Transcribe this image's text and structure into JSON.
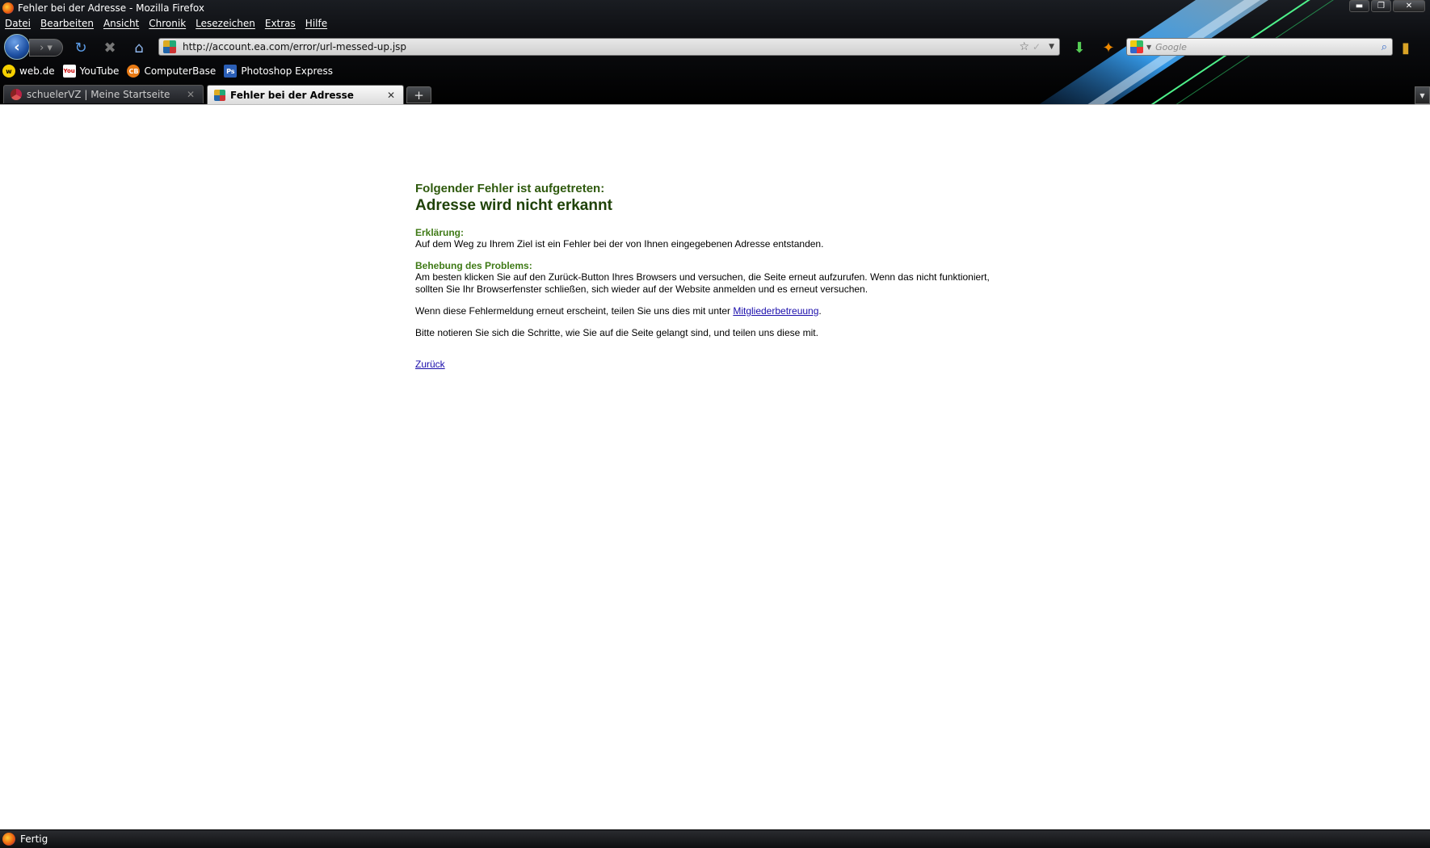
{
  "window": {
    "title": "Fehler bei der Adresse - Mozilla Firefox",
    "controls": {
      "minimize": "▬",
      "maximize": "❐",
      "close": "✕"
    }
  },
  "menu": [
    "Datei",
    "Bearbeiten",
    "Ansicht",
    "Chronik",
    "Lesezeichen",
    "Extras",
    "Hilfe"
  ],
  "nav": {
    "back_icon": "back-arrow-icon",
    "forward_icon": "forward-arrow-icon",
    "url": "http://account.ea.com/error/url-messed-up.jsp",
    "search_placeholder": "Google"
  },
  "bookmarks": [
    {
      "label": "web.de",
      "icon": "web.de"
    },
    {
      "label": "YouTube",
      "icon": "You Tube"
    },
    {
      "label": "ComputerBase",
      "icon": "CB"
    },
    {
      "label": "Photoshop Express",
      "icon": "Ps"
    }
  ],
  "tabs": [
    {
      "label": "schuelerVZ | Meine Startseite",
      "active": false
    },
    {
      "label": "Fehler bei der Adresse",
      "active": true
    }
  ],
  "page": {
    "kicker": "Folgender Fehler ist aufgetreten:",
    "heading": "Adresse wird nicht erkannt",
    "explanation_title": "Erklärung:",
    "explanation_text": "Auf dem Weg zu Ihrem Ziel ist ein Fehler bei der von Ihnen eingegebenen Adresse entstanden.",
    "fix_title": "Behebung des Problems:",
    "fix_text_1": "Am besten klicken Sie auf den Zurück-Button Ihres Browsers und versuchen, die Seite erneut aufzurufen. Wenn das nicht funktioniert,",
    "fix_text_2": "sollten Sie Ihr Browserfenster schließen, sich wieder auf der Website anmelden und es erneut versuchen.",
    "contact_prefix": "Wenn diese Fehlermeldung erneut erscheint, teilen Sie uns dies mit unter ",
    "contact_link": "Mitgliederbetreuung",
    "contact_suffix": ".",
    "notes_text": "Bitte notieren Sie sich die Schritte, wie Sie auf die Seite gelangt sind, und teilen uns diese mit.",
    "back_link": "Zurück"
  },
  "status": {
    "text": "Fertig"
  },
  "colors": {
    "accent_green": "#3f7a16",
    "heading_green": "#1f4208",
    "link": "#1a0dab"
  }
}
